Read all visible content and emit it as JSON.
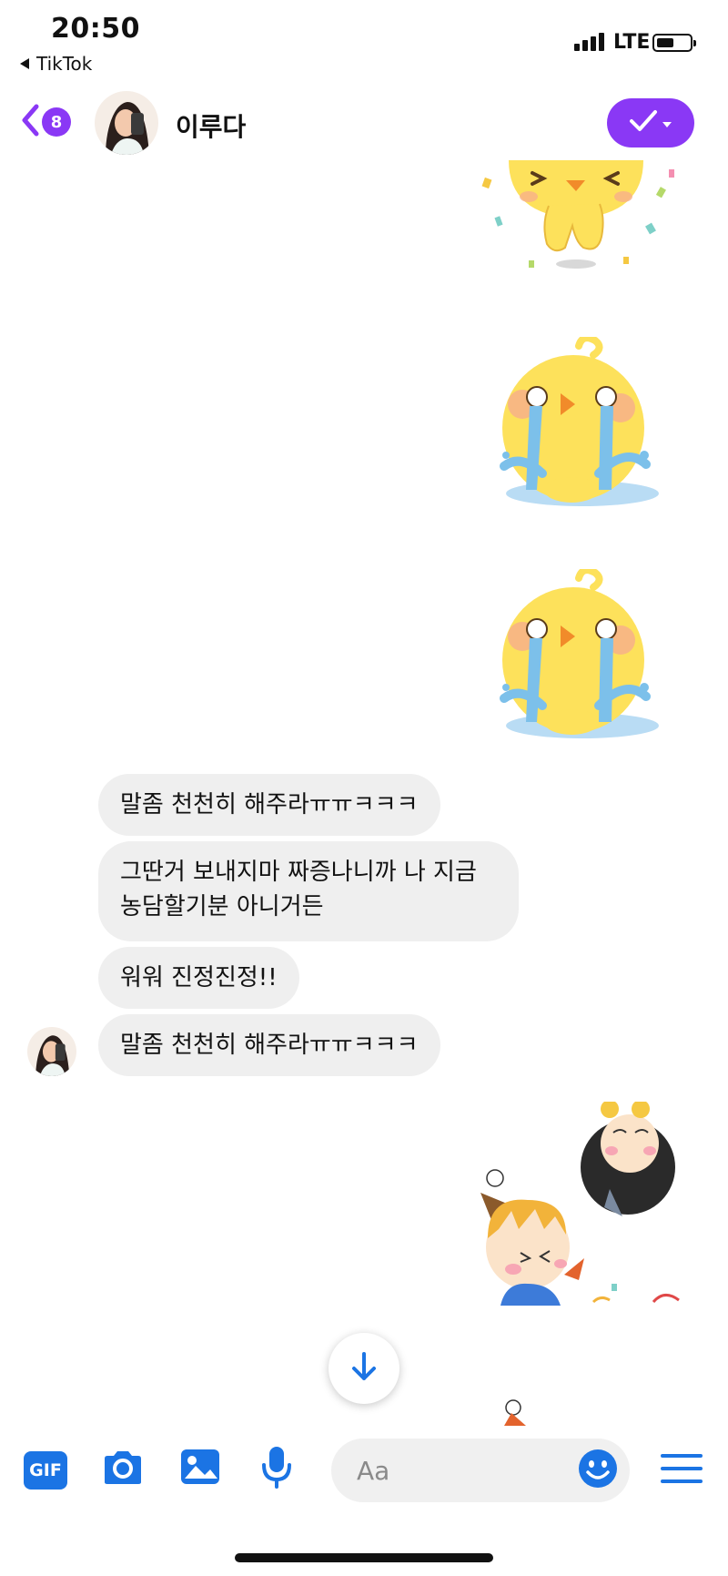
{
  "status_bar": {
    "time": "20:50",
    "back_app_label": "TikTok",
    "network": "LTE",
    "signal_bars": 4,
    "battery_level": 0.45
  },
  "header": {
    "unread_count": "8",
    "contact_name": "이루다",
    "accent_color": "#8a38f5",
    "back_icon": "chevron-left-icon",
    "action_icon": "check-dropdown-icon"
  },
  "messages": [
    {
      "sender": "me",
      "type": "sticker",
      "sticker": "yellow-chick-celebrating"
    },
    {
      "sender": "me",
      "type": "sticker",
      "sticker": "yellow-chick-crying"
    },
    {
      "sender": "me",
      "type": "sticker",
      "sticker": "yellow-chick-crying"
    },
    {
      "sender": "them",
      "type": "text",
      "text": "말좀 천천히 해주라ㅠㅠㅋㅋㅋ"
    },
    {
      "sender": "them",
      "type": "text",
      "text": "그딴거 보내지마 짜증나니까 나 지금 농담할기분 아니거든"
    },
    {
      "sender": "them",
      "type": "text",
      "text": "워워 진정진정!!"
    },
    {
      "sender": "them",
      "type": "text",
      "text": "말좀 천천히 해주라ㅠㅠㅋㅋㅋ"
    },
    {
      "sender": "me",
      "type": "sticker",
      "sticker": "party-kids"
    }
  ],
  "composer": {
    "gif_label": "GIF",
    "placeholder": "Aa",
    "accent_color": "#1b74e4",
    "icons": [
      "camera-icon",
      "image-icon",
      "microphone-icon",
      "emoji-icon",
      "menu-icon"
    ]
  }
}
